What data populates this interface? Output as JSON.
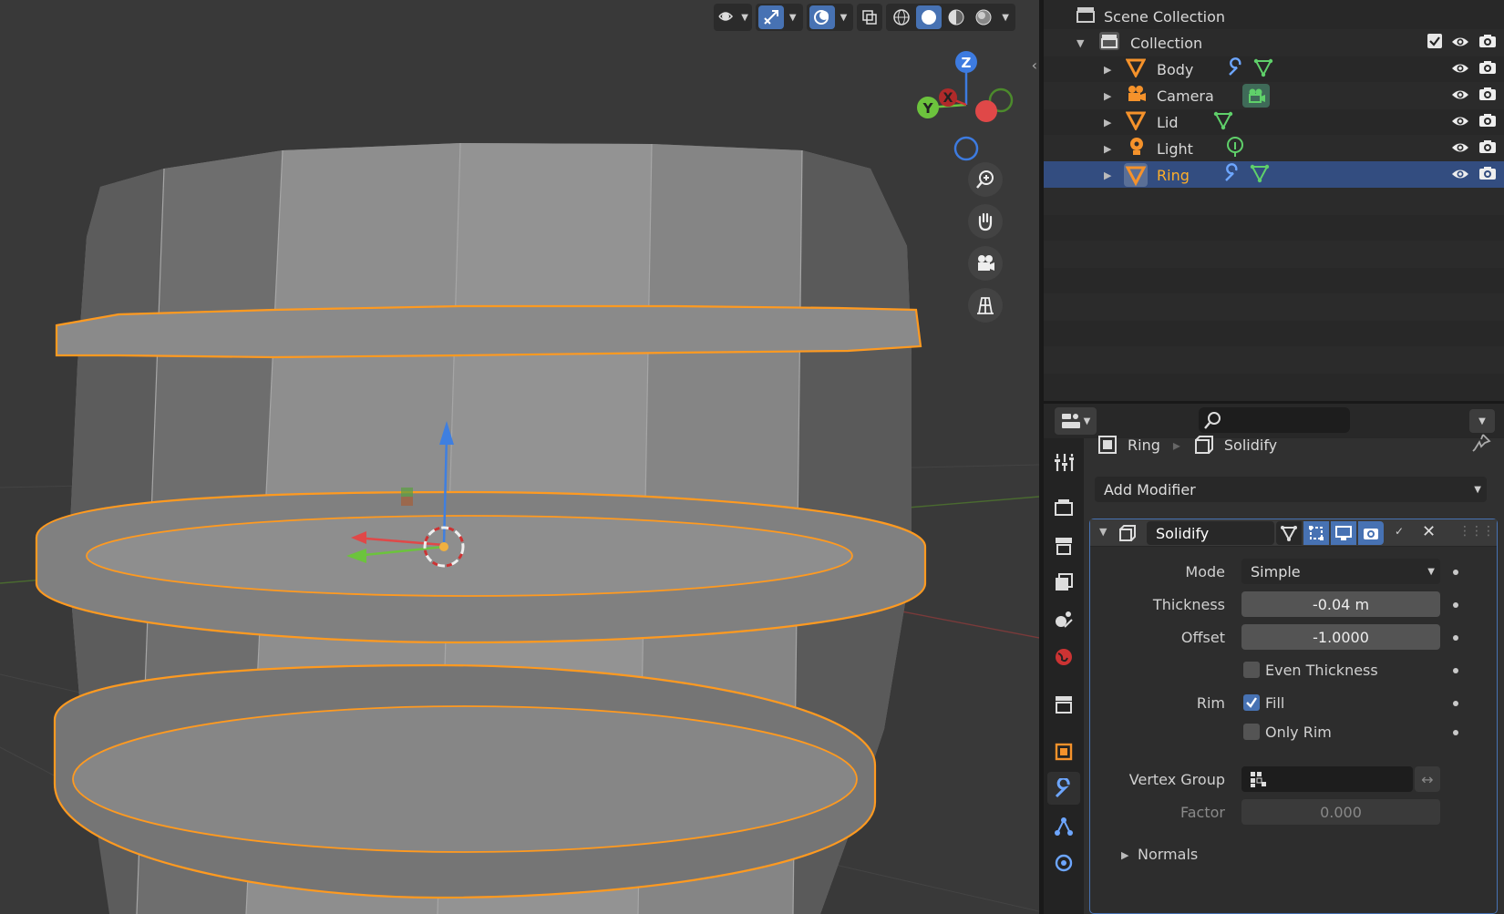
{
  "colors": {
    "viewport_bg": "#393939",
    "selection_outline": "#ff9a20",
    "mesh_face": "#8a8a8a",
    "accent": "#4772b3",
    "outliner_selected_text": "#ffaf29"
  },
  "viewport": {
    "header_icons": [
      "view-object-types-icon",
      "gizmo-toggle-icon",
      "overlay-toggle-icon",
      "xray-icon",
      "wireframe-shading-icon",
      "solid-shading-icon",
      "material-shading-icon",
      "rendered-shading-icon"
    ],
    "axis_labels": {
      "z": "Z",
      "y": "Y",
      "x": "X"
    },
    "nav_icons": [
      "zoom-icon",
      "pan-hand-icon",
      "camera-view-icon",
      "ortho-grid-icon"
    ]
  },
  "outliner": {
    "root": "Scene Collection",
    "collection": "Collection",
    "objects": [
      {
        "name": "Body",
        "icons": [
          "wrench-icon",
          "mesh-data-icon"
        ]
      },
      {
        "name": "Camera",
        "icons": [
          "camera-data-icon"
        ]
      },
      {
        "name": "Lid",
        "icons": [
          "mesh-data-icon"
        ]
      },
      {
        "name": "Light",
        "icons": [
          "light-data-icon"
        ]
      },
      {
        "name": "Ring",
        "icons": [
          "wrench-icon",
          "mesh-data-icon"
        ],
        "selected": true
      }
    ]
  },
  "properties": {
    "breadcrumb_object": "Ring",
    "breadcrumb_modifier": "Solidify",
    "add_modifier": "Add Modifier",
    "modifier_name": "Solidify",
    "mode_label": "Mode",
    "mode_value": "Simple",
    "thickness_label": "Thickness",
    "thickness_value": "-0.04 m",
    "offset_label": "Offset",
    "offset_value": "-1.0000",
    "even_thickness": "Even Thickness",
    "rim_label": "Rim",
    "fill": "Fill",
    "only_rim": "Only Rim",
    "vertex_group_label": "Vertex Group",
    "factor_label": "Factor",
    "factor_value": "0.000",
    "normals": "Normals"
  }
}
